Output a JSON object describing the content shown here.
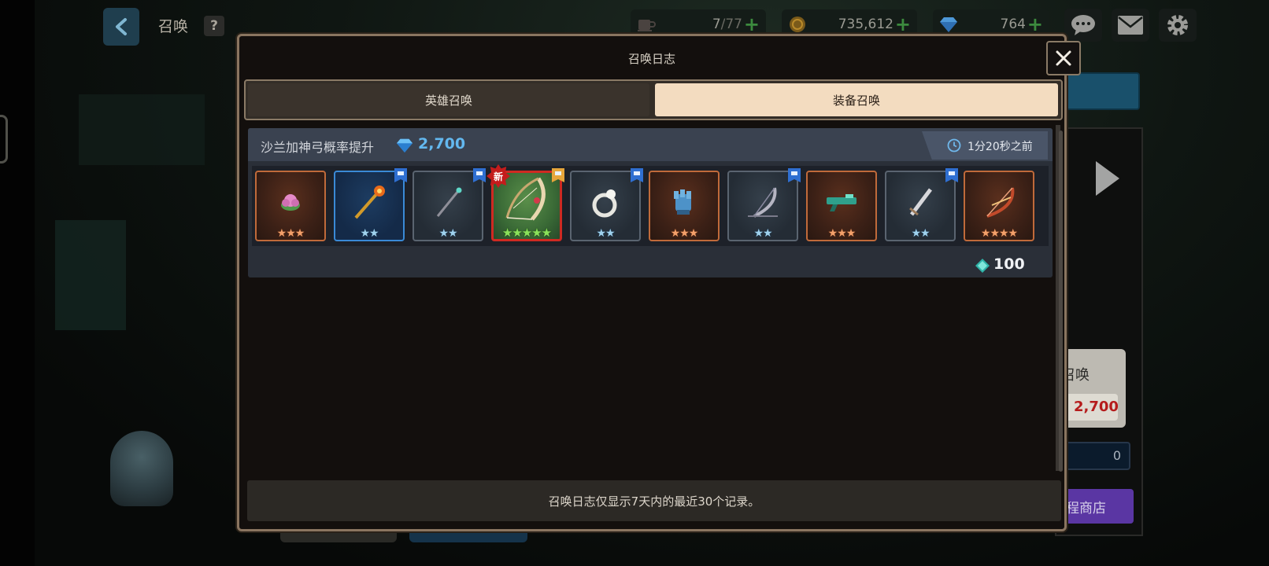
{
  "header": {
    "title": "召唤",
    "help_label": "?"
  },
  "resources": {
    "stamina": {
      "value": "7",
      "max": "/77",
      "icon": "coffee-cup-icon"
    },
    "gold": {
      "value": "735,612",
      "icon": "gold-coin-icon"
    },
    "gems": {
      "value": "764",
      "icon": "gem-icon"
    },
    "plus_label": "+"
  },
  "top_icons": [
    "chat-icon",
    "mail-icon",
    "gear-icon"
  ],
  "background_panel": {
    "card_title": "召唤",
    "card_cost": "2,700",
    "count": "0",
    "shop_label": "程商店"
  },
  "modal": {
    "title": "召唤日志",
    "tabs": [
      {
        "label": "英雄召唤",
        "active": false
      },
      {
        "label": "装备召唤",
        "active": true
      }
    ],
    "footer_text": "召唤日志仅显示7天内的最近30个记录。"
  },
  "record": {
    "name": "沙兰加神弓概率提升",
    "cost": "2,700",
    "time": "1分20秒之前",
    "shard_count": "100",
    "items": [
      {
        "name": "lotus-accessory",
        "stars": "★★★",
        "star_color": "orange",
        "rarity": "r3",
        "badge": ""
      },
      {
        "name": "golden-staff",
        "stars": "★★",
        "star_color": "blue",
        "rarity": "r2b",
        "badge": "flag"
      },
      {
        "name": "wand",
        "stars": "★★",
        "star_color": "blue",
        "rarity": "r2",
        "badge": "flag"
      },
      {
        "name": "sarangga-bow",
        "stars": "★★★★★",
        "star_color": "green",
        "rarity": "r5",
        "badge": "flag-gold",
        "new_label": "新"
      },
      {
        "name": "ring",
        "stars": "★★",
        "star_color": "blue",
        "rarity": "r2",
        "badge": "flag"
      },
      {
        "name": "gauntlet",
        "stars": "★★★",
        "star_color": "orange",
        "rarity": "r3",
        "badge": ""
      },
      {
        "name": "silver-bow",
        "stars": "★★",
        "star_color": "blue",
        "rarity": "r2",
        "badge": "flag"
      },
      {
        "name": "green-rifle",
        "stars": "★★★",
        "star_color": "orange",
        "rarity": "r3",
        "badge": ""
      },
      {
        "name": "short-sword",
        "stars": "★★",
        "star_color": "blue",
        "rarity": "r2",
        "badge": "flag"
      },
      {
        "name": "flame-bow",
        "stars": "★★★★",
        "star_color": "orange",
        "rarity": "r4",
        "badge": ""
      }
    ]
  },
  "colors": {
    "gem_blue": "#63b8ef",
    "active_tab": "#f3dcc0",
    "new_badge": "#c41c1c"
  }
}
